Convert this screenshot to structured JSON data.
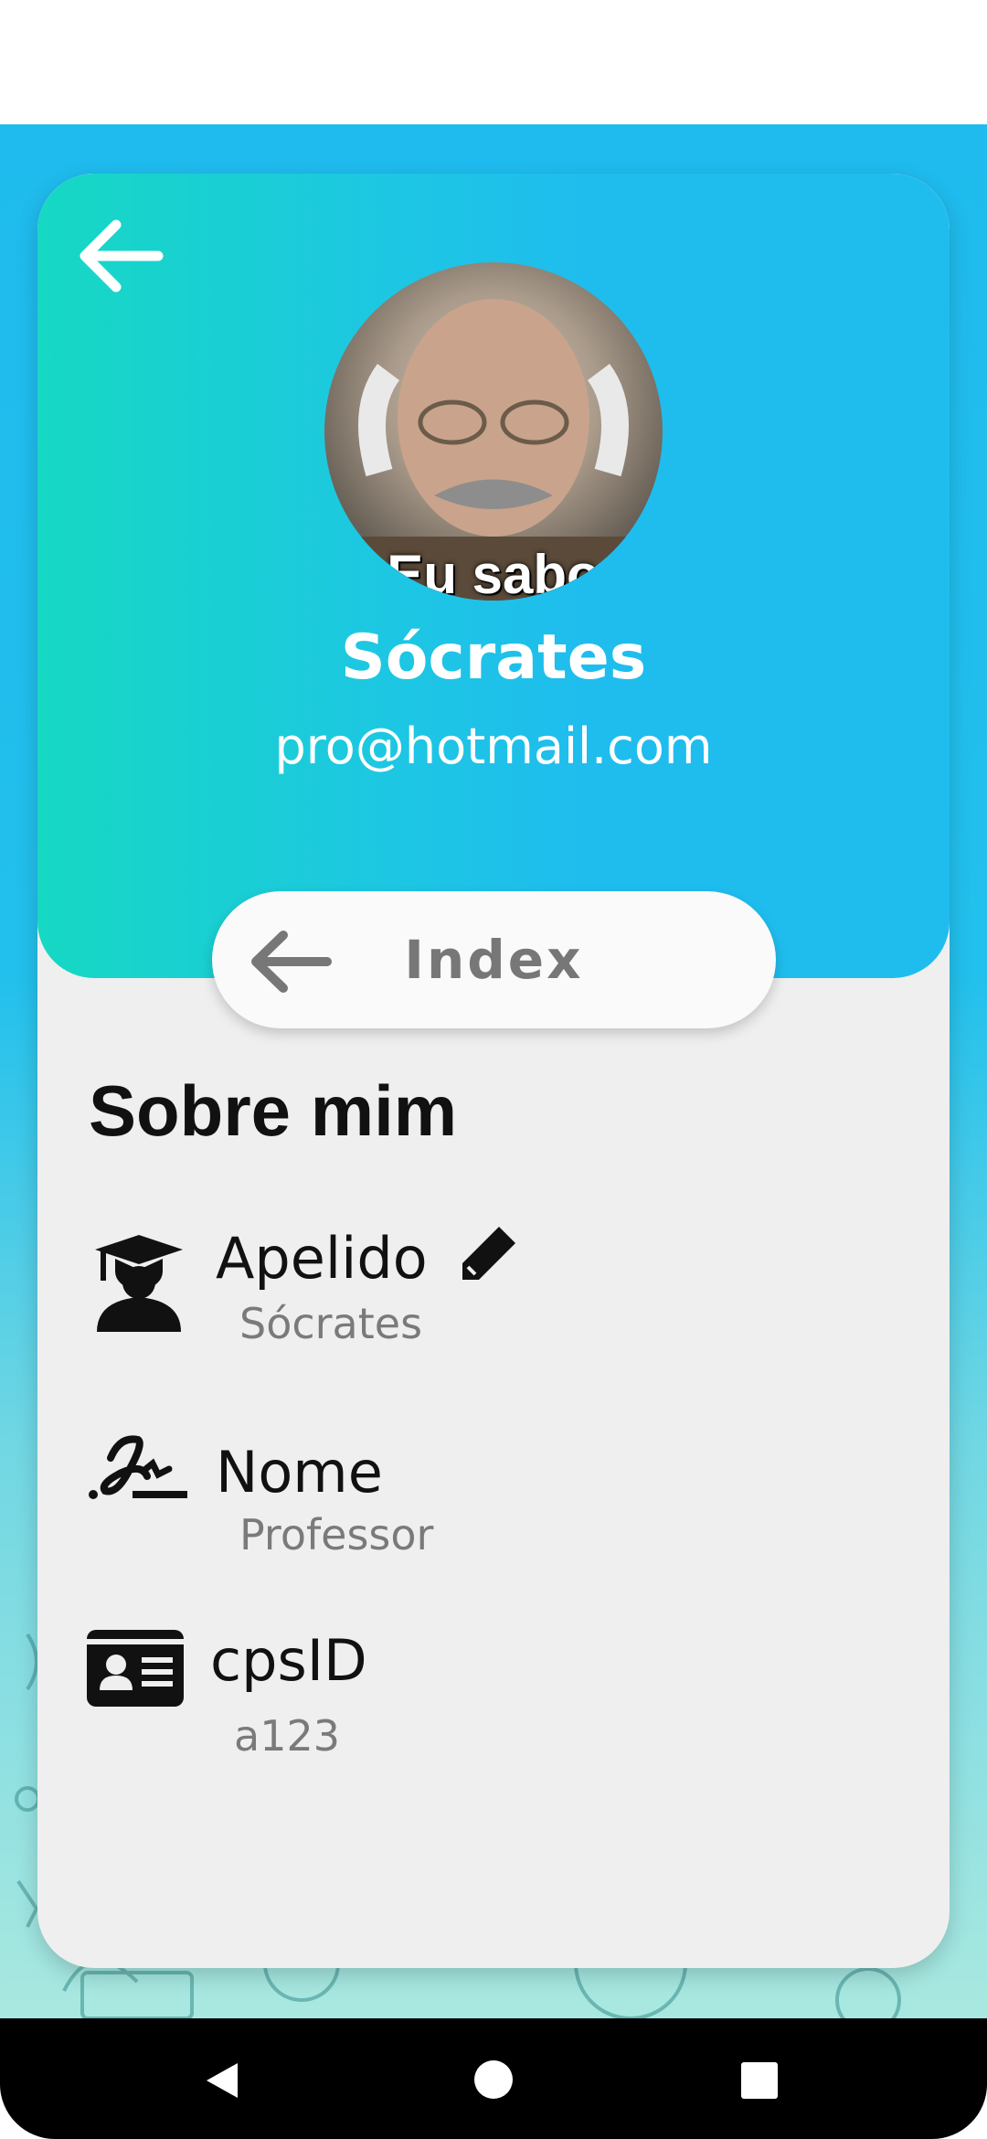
{
  "profile": {
    "name": "Sócrates",
    "email": "pro@hotmail.com",
    "avatar_caption": "Eu sabo"
  },
  "index_button": {
    "label": "Index"
  },
  "about": {
    "title": "Sobre mim",
    "fields": [
      {
        "label": "Apelido",
        "value": "Sócrates",
        "icon": "graduate-icon",
        "editable": true
      },
      {
        "label": "Nome",
        "value": "Professor",
        "icon": "signature-icon"
      },
      {
        "label": "cpsID",
        "value": "a123",
        "icon": "id-card-icon"
      }
    ]
  },
  "icons": [
    "back-arrow-icon",
    "pencil-icon",
    "nav-back-icon",
    "nav-home-icon",
    "nav-recents-icon"
  ],
  "colors": {
    "header_gradient_start": "#16d8c3",
    "header_gradient_end": "#1fbdee",
    "card_bg": "#efefef",
    "label_text": "#111111",
    "value_text": "#7a7a7a"
  }
}
